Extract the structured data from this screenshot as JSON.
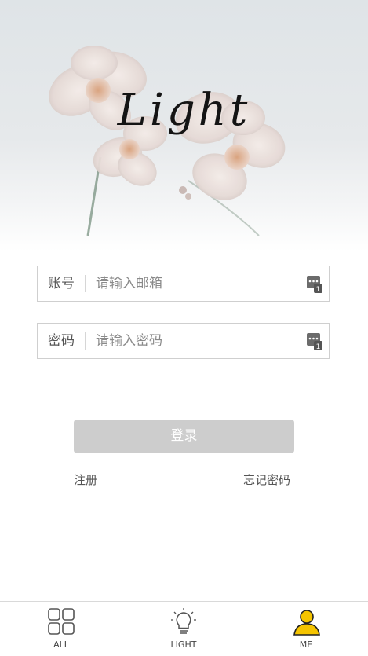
{
  "hero": {
    "logo_text": "Light"
  },
  "account": {
    "label": "账号",
    "placeholder": "请输入邮箱",
    "value": ""
  },
  "password": {
    "label": "密码",
    "placeholder": "请输入密码",
    "value": ""
  },
  "login_button": "登录",
  "register_link": "注册",
  "forgot_link": "忘记密码",
  "tabbar": {
    "items": [
      {
        "label": "ALL",
        "icon": "grid-icon"
      },
      {
        "label": "LIGHT",
        "icon": "lightbulb-icon"
      },
      {
        "label": "ME",
        "icon": "user-icon",
        "active": true
      }
    ],
    "active_color": "#f5c400"
  }
}
